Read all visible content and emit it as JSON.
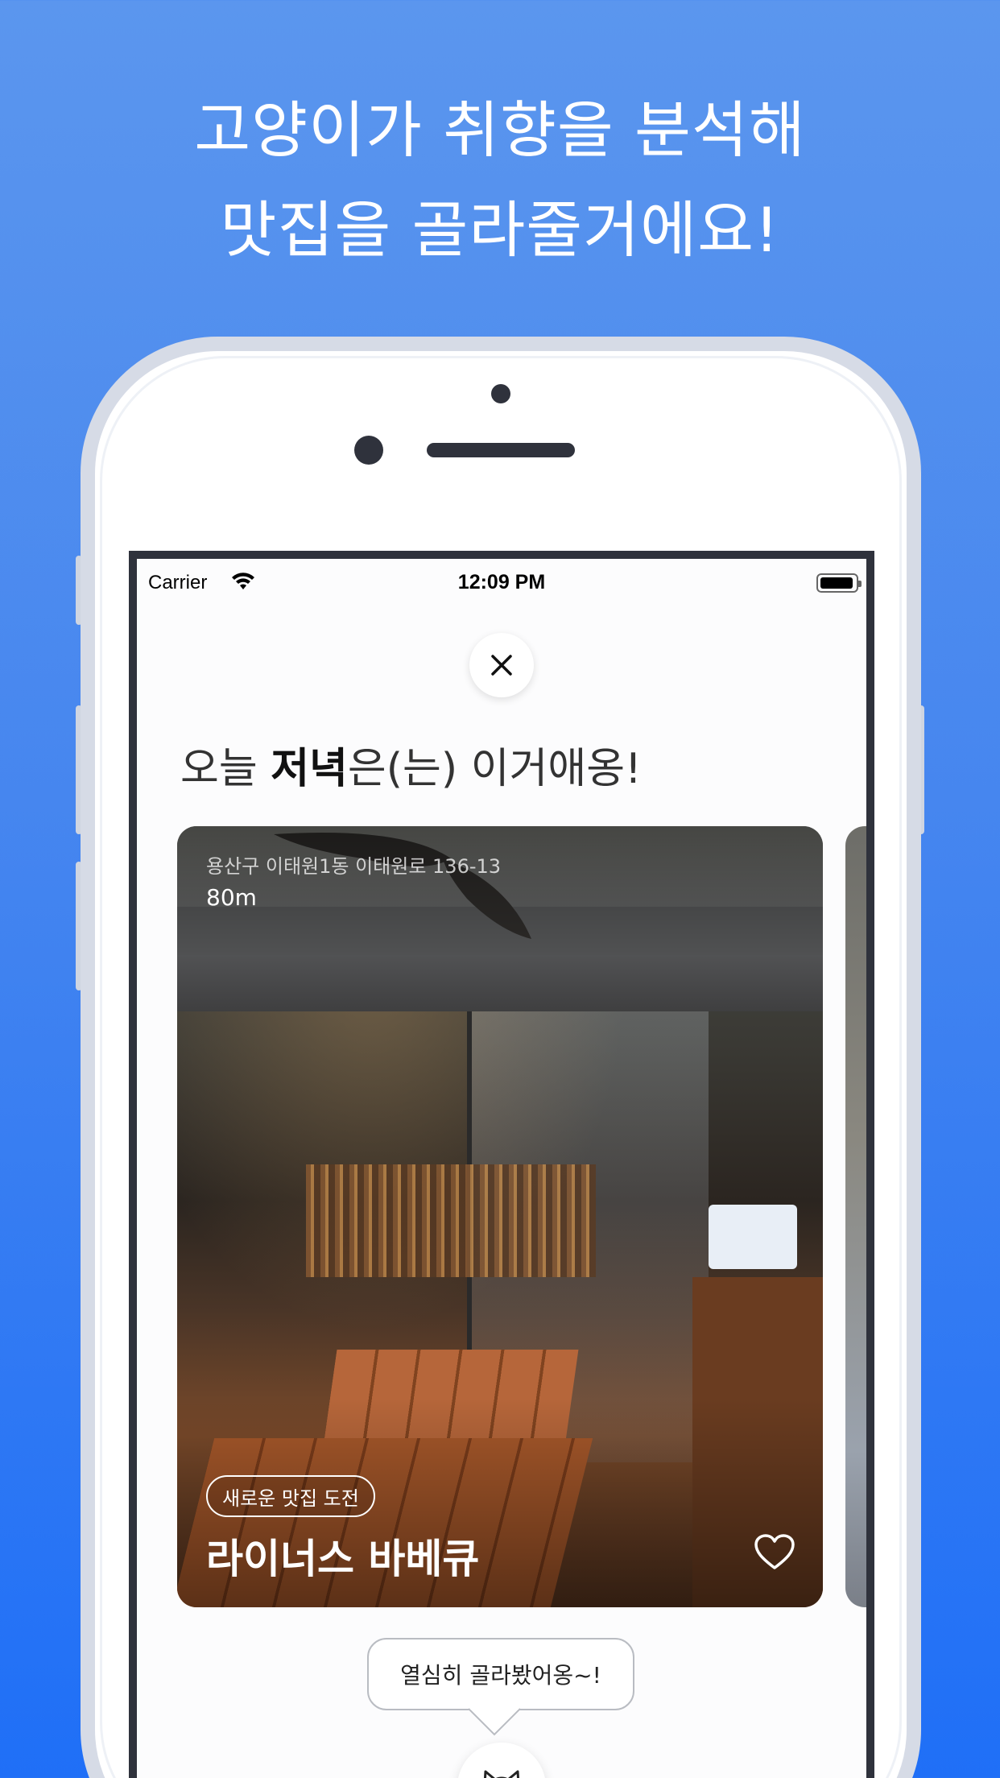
{
  "headline": {
    "line1": "고양이가 취향을 분석해",
    "line2": "맛집을 골라줄거에요!"
  },
  "status_bar": {
    "carrier": "Carrier",
    "time": "12:09 PM"
  },
  "screen": {
    "title_prefix": "오늘 ",
    "title_meal": "저녁",
    "title_suffix": "은(는) 이거애옹!",
    "restaurant": {
      "address": "용산구 이태원1동 이태원로 136-13",
      "distance": "80m",
      "tag": "새로운 맛집 도전",
      "name": "라이너스 바베큐"
    },
    "speech_bubble": "열심히 골라봤어옹~!"
  },
  "colors": {
    "background_top": "#5b96ee",
    "background_bottom": "#1f6ff7",
    "phone_frame": "#d6dbe6",
    "screen_bezel": "#2f323c"
  },
  "icons": [
    "wifi-icon",
    "battery-icon",
    "close-icon",
    "heart-icon",
    "cat-icon"
  ]
}
